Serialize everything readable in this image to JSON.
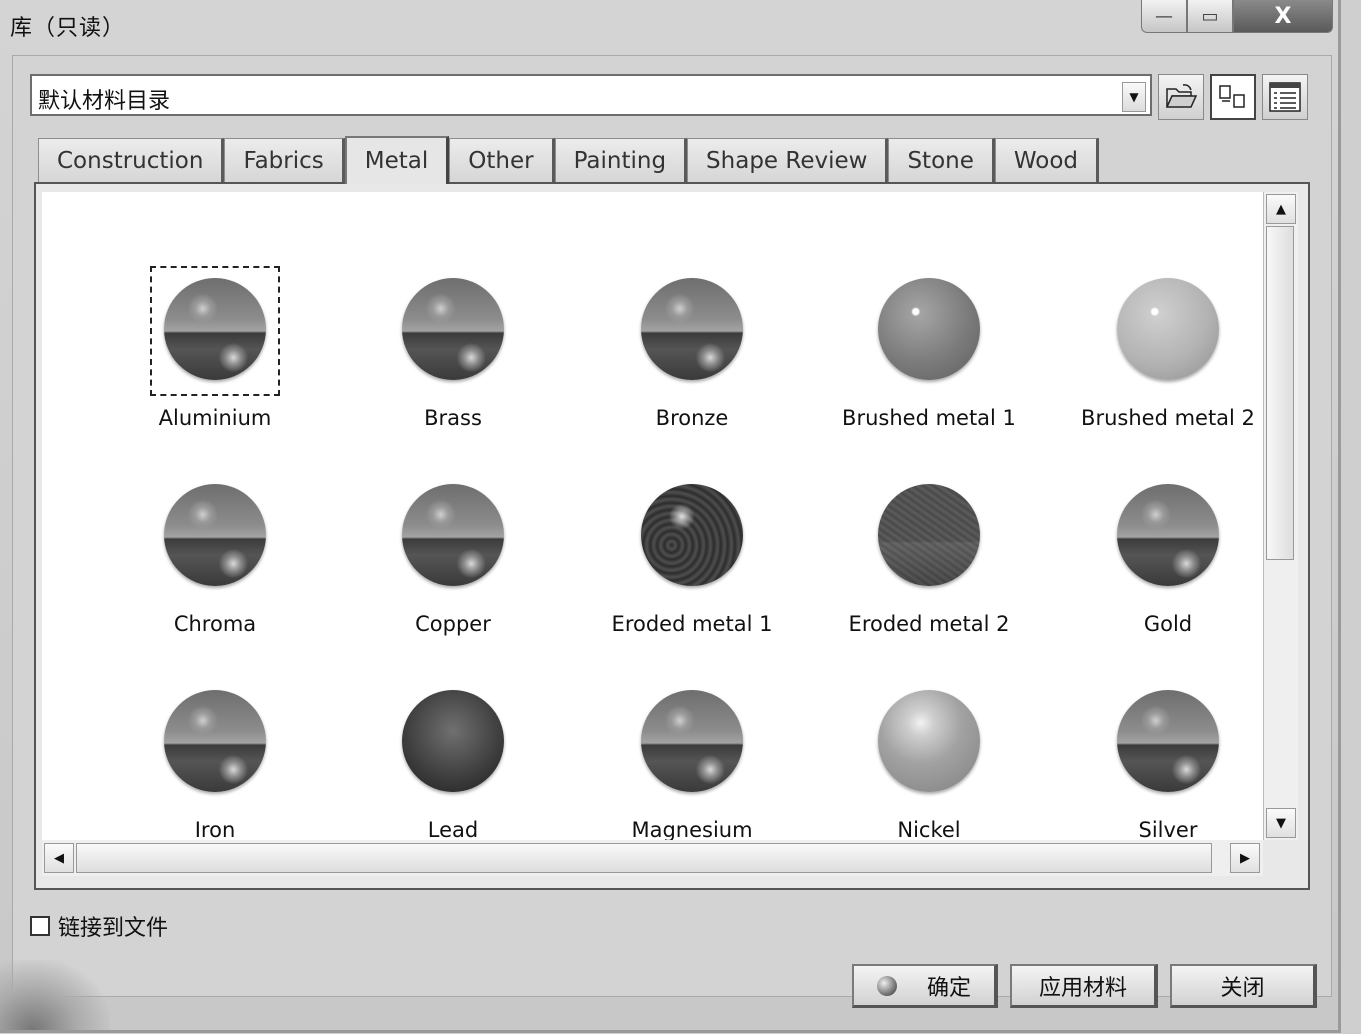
{
  "window": {
    "title": "库（只读）",
    "controls": {
      "minimize": "—",
      "maximize": "▭",
      "close": "X"
    }
  },
  "catalog": {
    "selected": "默认材料目录",
    "arrow": "▼"
  },
  "toolbar": {
    "open_icon": "folder-open-icon",
    "icon_view_icon": "large-icons-view-icon",
    "list_view_icon": "details-view-icon"
  },
  "tabs": [
    {
      "label": "Construction"
    },
    {
      "label": "Fabrics"
    },
    {
      "label": "Metal",
      "active": true
    },
    {
      "label": "Other"
    },
    {
      "label": "Painting"
    },
    {
      "label": "Shape Review"
    },
    {
      "label": "Stone"
    },
    {
      "label": "Wood"
    }
  ],
  "materials": [
    {
      "name": "Aluminium",
      "style": "a",
      "selected": true
    },
    {
      "name": "Brass",
      "style": "a"
    },
    {
      "name": "Bronze",
      "style": "a"
    },
    {
      "name": "Brushed metal 1",
      "style": "b"
    },
    {
      "name": "Brushed metal 2",
      "style": "c"
    },
    {
      "name": "Chroma",
      "style": "a"
    },
    {
      "name": "Copper",
      "style": "a"
    },
    {
      "name": "Eroded metal 1",
      "style": "e1"
    },
    {
      "name": "Eroded metal 2",
      "style": "e2"
    },
    {
      "name": "Gold",
      "style": "a"
    },
    {
      "name": "Iron",
      "style": "a"
    },
    {
      "name": "Lead",
      "style": "lead"
    },
    {
      "name": "Magnesium",
      "style": "a"
    },
    {
      "name": "Nickel",
      "style": "nickel"
    },
    {
      "name": "Silver",
      "style": "a"
    }
  ],
  "scroll": {
    "up": "▲",
    "down": "▼",
    "left": "◀",
    "right": "▶"
  },
  "link_to_file": {
    "label": "链接到文件",
    "checked": false
  },
  "buttons": {
    "ok": "确定",
    "apply": "应用材料",
    "close": "关闭"
  }
}
